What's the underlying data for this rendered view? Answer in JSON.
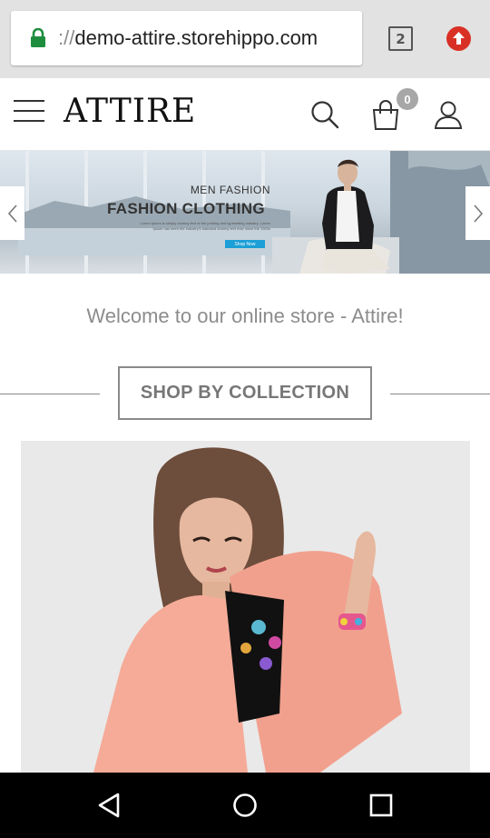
{
  "browser": {
    "url_scheme": "://",
    "url_host": "demo-attire.storehippo.com",
    "tab_count": "2",
    "icons": [
      "lock-icon",
      "tabs-icon",
      "update-icon"
    ],
    "accent": "#d93025",
    "secure_color": "#1e8e3e"
  },
  "header": {
    "logo": "ATTIRE",
    "cart_count": "0",
    "icons": [
      "menu-icon",
      "search-icon",
      "cart-icon",
      "account-icon"
    ]
  },
  "hero": {
    "subtitle": "MEN FASHION",
    "title": "FASHION CLOTHING",
    "body": "Lorem Ipsum is simply dummy text of the printing and typesetting industry. Lorem Ipsum has been the industry's standard dummy text ever since the 1500s",
    "button": "Shop Now",
    "button_color": "#1b9fd6"
  },
  "welcome": "Welcome to our online store - Attire!",
  "collection": {
    "heading": "SHOP BY COLLECTION"
  },
  "system_nav": {
    "icons": [
      "back-icon",
      "home-icon",
      "recents-icon"
    ]
  }
}
